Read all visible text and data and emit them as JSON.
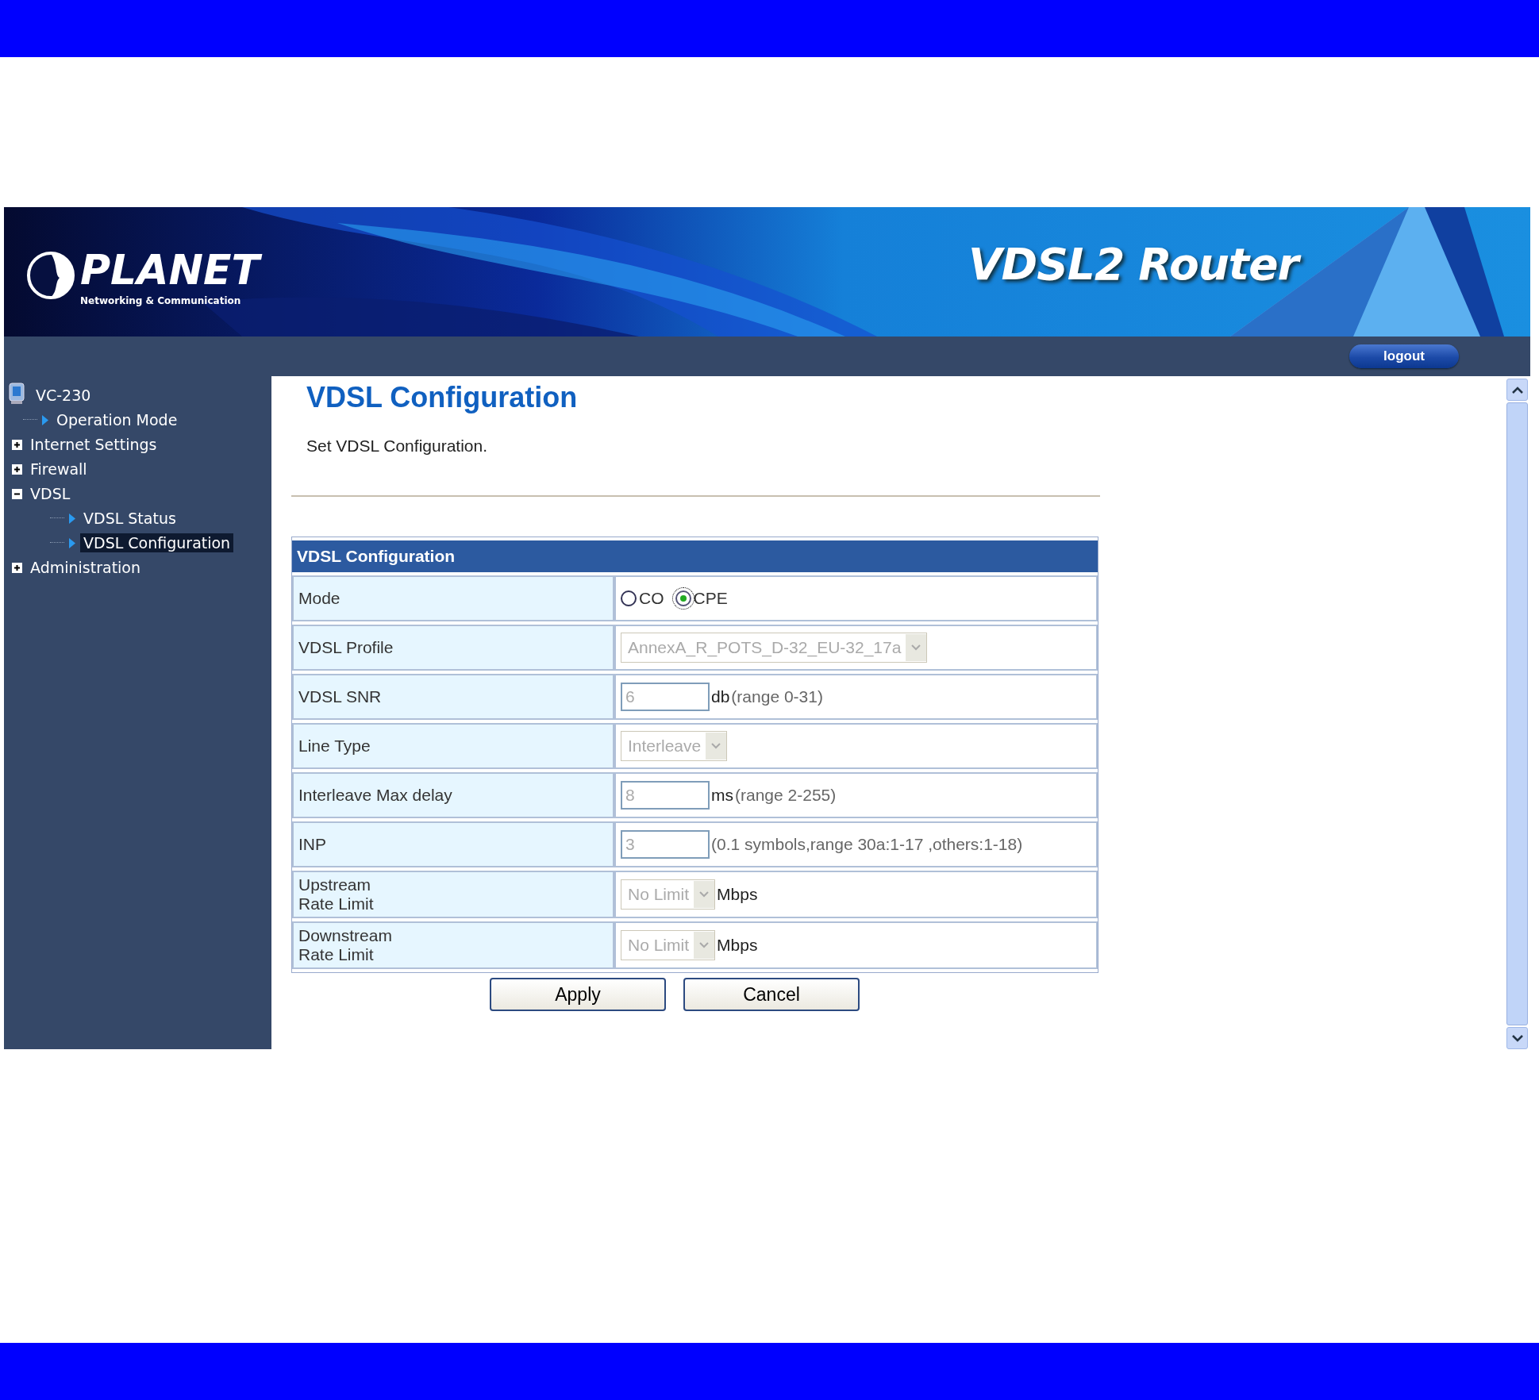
{
  "header": {
    "brand": "PLANET",
    "tagline": "Networking & Communication",
    "product": "VDSL2 Router",
    "logout": "logout"
  },
  "sidebar": {
    "items": [
      {
        "label": "VC-230",
        "kind": "root",
        "selected": false,
        "children": [
          {
            "label": "Operation Mode",
            "kind": "page",
            "selected": false
          },
          {
            "label": "Internet Settings",
            "kind": "folder",
            "expanded": false,
            "selected": false
          },
          {
            "label": "Firewall",
            "kind": "folder",
            "expanded": false,
            "selected": false
          },
          {
            "label": "VDSL",
            "kind": "folder",
            "expanded": true,
            "selected": false,
            "children": [
              {
                "label": "VDSL Status",
                "kind": "page",
                "selected": false
              },
              {
                "label": "VDSL Configuration",
                "kind": "page",
                "selected": true
              }
            ]
          },
          {
            "label": "Administration",
            "kind": "folder",
            "expanded": false,
            "selected": false
          }
        ]
      }
    ]
  },
  "page": {
    "title": "VDSL Configuration",
    "description": "Set VDSL Configuration.",
    "table": {
      "heading": "VDSL Configuration",
      "rows": [
        {
          "label": "Mode",
          "kind": "radio",
          "options": [
            {
              "label": "CO",
              "selected": false
            },
            {
              "label": "CPE",
              "selected": true
            }
          ]
        },
        {
          "label": "VDSL Profile",
          "kind": "select",
          "value": "AnnexA_R_POTS_D-32_EU-32_17a",
          "disabled": true
        },
        {
          "label": "VDSL SNR",
          "kind": "text",
          "value": "6",
          "disabled": true,
          "suffix": "db",
          "note": "(range 0-31)"
        },
        {
          "label": "Line Type",
          "kind": "select",
          "value": "Interleave",
          "disabled": true
        },
        {
          "label": "Interleave Max delay",
          "kind": "text",
          "value": "8",
          "disabled": true,
          "suffix": "ms",
          "note": "(range 2-255)"
        },
        {
          "label": "INP",
          "kind": "text",
          "value": "3",
          "disabled": true,
          "note": "(0.1 symbols,range 30a:1-17 ,others:1-18)"
        },
        {
          "label": "Upstream\nRate Limit",
          "kind": "select",
          "value": "No Limit",
          "disabled": true,
          "suffix": "Mbps"
        },
        {
          "label": "Downstream\nRate Limit",
          "kind": "select",
          "value": "No Limit",
          "disabled": true,
          "suffix": "Mbps"
        }
      ]
    },
    "buttons": [
      "Apply",
      "Cancel"
    ]
  }
}
